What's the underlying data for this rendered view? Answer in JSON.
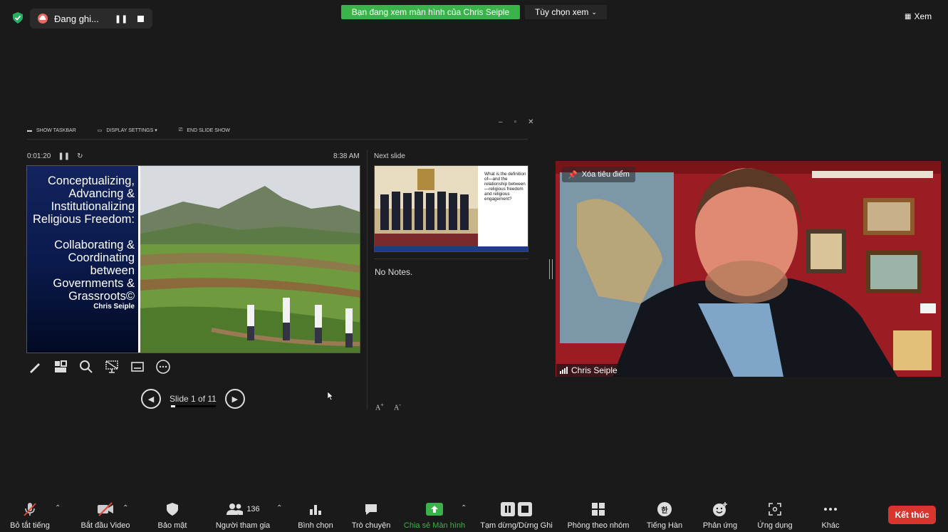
{
  "topbar": {
    "recording_label": "Đang ghi...",
    "banner_text": "Bạn đang xem màn hình của Chris Seiple",
    "view_options_label": "Tùy chọn xem",
    "view_label": "Xem"
  },
  "presenter": {
    "show_taskbar": "SHOW TASKBAR",
    "display_settings": "DISPLAY SETTINGS ▾",
    "end_slide_show": "END SLIDE SHOW",
    "elapsed": "0:01:20",
    "clock": "8:38 AM",
    "next_slide_label": "Next slide",
    "notes": "No Notes.",
    "slide_counter": "Slide 1 of 11",
    "progress_fraction": 0.09
  },
  "slide": {
    "title_lines": [
      "Conceptualizing,",
      "Advancing &",
      "Institutionalizing",
      "Religious Freedom:"
    ],
    "subtitle_lines": [
      "Collaborating &",
      "Coordinating",
      "between",
      "Governments &",
      "Grassroots©"
    ],
    "author": "Chris Seiple"
  },
  "next_slide": {
    "text": "What is the definition of—and the relationship between—religious freedom and religious engagement?"
  },
  "video": {
    "pin_label": "Xóa tiêu điểm",
    "participant_name": "Chris Seiple"
  },
  "toolbar": {
    "mute": "Bỏ tắt tiếng",
    "video": "Bắt đầu Video",
    "security": "Bảo mật",
    "participants": "Người tham gia",
    "participants_count": "136",
    "polls": "Bình chọn",
    "chat": "Trò chuyện",
    "share": "Chia sẻ Màn hình",
    "pause_record": "Tạm dừng/Dừng Ghi",
    "breakout": "Phòng theo nhóm",
    "korean": "Tiếng Hàn",
    "korean_glyph": "한",
    "reactions": "Phản ứng",
    "apps": "Ứng dụng",
    "more": "Khác",
    "end": "Kết thúc"
  },
  "colors": {
    "share_green": "#3ab34a",
    "end_red": "#d8352f"
  }
}
